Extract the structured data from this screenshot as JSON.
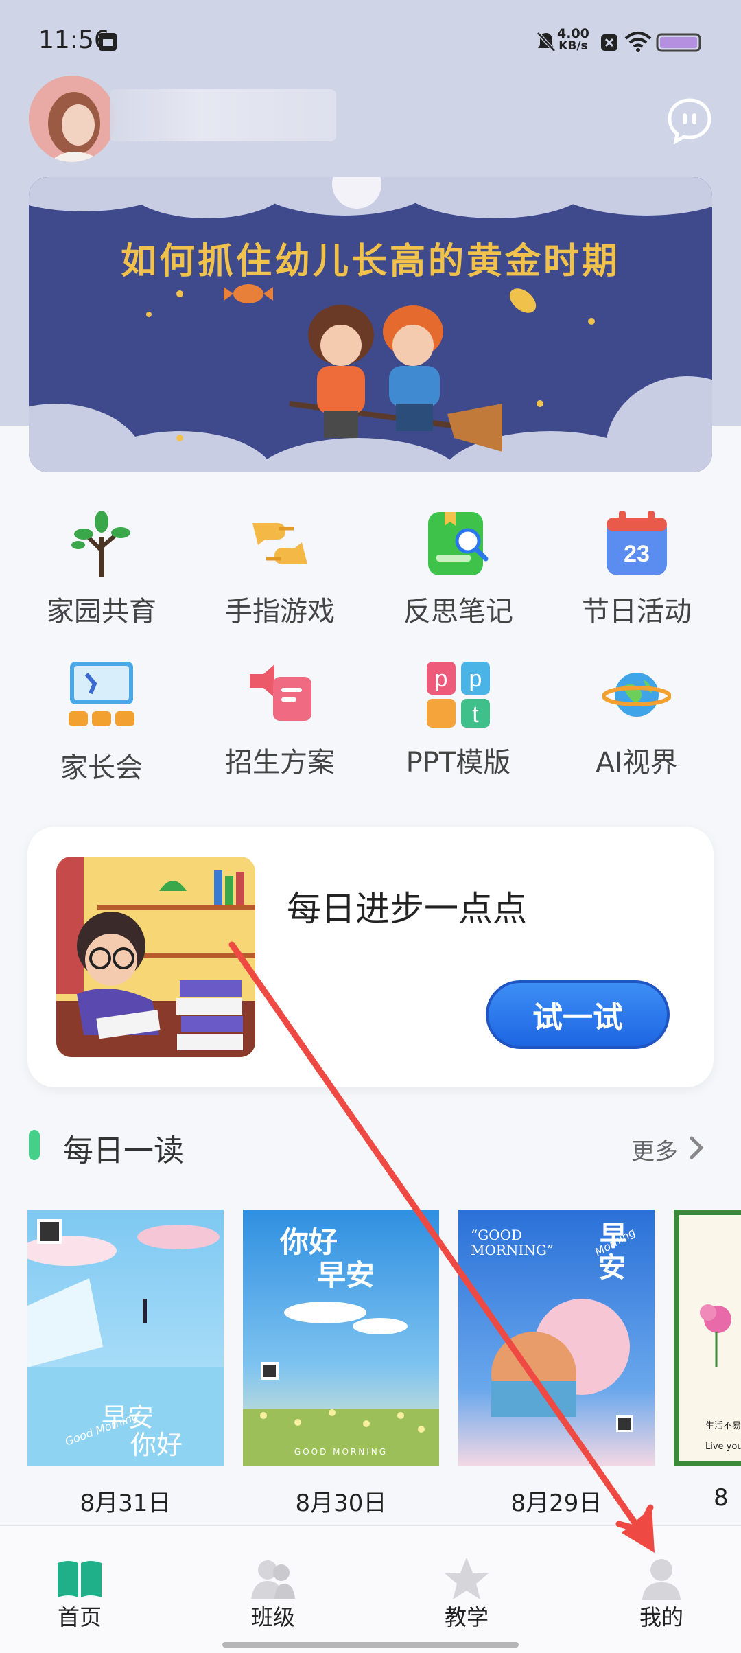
{
  "status_bar": {
    "time": "11:56",
    "speed_value": "4.00",
    "speed_unit": "KB/s"
  },
  "banner": {
    "title": "如何抓住幼儿长高的黄金时期"
  },
  "grid": {
    "items": [
      {
        "label": "家园共育",
        "icon": "sprout-icon"
      },
      {
        "label": "手指游戏",
        "icon": "hands-icon"
      },
      {
        "label": "反思笔记",
        "icon": "notebook-search-icon"
      },
      {
        "label": "节日活动",
        "icon": "calendar-icon"
      },
      {
        "label": "家长会",
        "icon": "meeting-board-icon"
      },
      {
        "label": "招生方案",
        "icon": "megaphone-icon"
      },
      {
        "label": "PPT模版",
        "icon": "ppt-icon"
      },
      {
        "label": "AI视界",
        "icon": "planet-icon"
      }
    ]
  },
  "progress_card": {
    "title": "每日进步一点点",
    "button_label": "试一试"
  },
  "daily_read": {
    "title": "每日一读",
    "more_label": "更多",
    "cards": [
      {
        "date": "8月31日",
        "text_main": "早安",
        "text_sub": "你好",
        "script": "Good Morning"
      },
      {
        "date": "8月30日",
        "text_main": "你好",
        "text_sub": "早安",
        "footer": "GOOD MORNING"
      },
      {
        "date": "8月29日",
        "text_main": "早",
        "text_sub": "安",
        "header": "“GOOD MORNING”",
        "script": "Morning"
      },
      {
        "date": "8",
        "text_main": "生活不易",
        "text_sub": "Live your"
      }
    ]
  },
  "bottom_nav": {
    "items": [
      {
        "label": "首页",
        "icon": "book-icon",
        "active": true
      },
      {
        "label": "班级",
        "icon": "class-users-icon",
        "active": false
      },
      {
        "label": "教学",
        "icon": "star-icon",
        "active": false
      },
      {
        "label": "我的",
        "icon": "profile-icon",
        "active": false
      }
    ]
  },
  "colors": {
    "accent_green": "#45d08a",
    "button_blue": "#2a78ec",
    "banner_bg": "#3f4a8c",
    "banner_title": "#f1c24b",
    "annotation_arrow": "#ee4a43"
  }
}
